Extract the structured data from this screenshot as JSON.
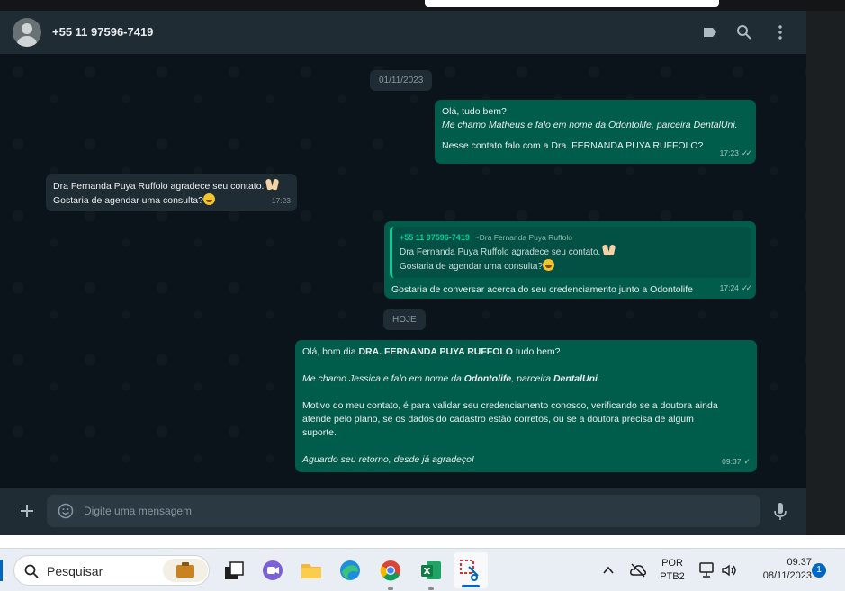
{
  "header": {
    "contact_name": "+55 11 97596-7419",
    "icons": [
      "label-icon",
      "search-icon",
      "menu-icon"
    ]
  },
  "chat": {
    "date_pill_1": "01/11/2023",
    "msg1": {
      "l1": "Olá, tudo bem?",
      "l2": "Me chamo Matheus e falo em nome da Odontolife, parceira DentalUni.",
      "l3": "Nesse contato falo com a Dra. FERNANDA PUYA RUFFOLO?",
      "time": "17:23"
    },
    "msg2": {
      "l1": "Dra Fernanda Puya Ruffolo agradece seu contato.",
      "l2": "Gostaria de agendar uma consulta?",
      "time": "17:23"
    },
    "msg3": {
      "quote_name": "+55 11 97596-7419",
      "quote_sub": "~Dra Fernanda Puya Ruffolo",
      "quote_l1": "Dra Fernanda Puya Ruffolo agradece seu contato.",
      "quote_l2": "Gostaria de agendar uma consulta?",
      "text": "Gostaria de conversar acerca do seu credenciamento junto a Odontolife",
      "time": "17:24"
    },
    "date_pill_2": "HOJE",
    "msg4": {
      "p1a": "Olá, bom dia ",
      "p1b": "DRA. FERNANDA PUYA RUFFOLO",
      "p1c": " tudo bem?",
      "p2a": "Me chamo Jessica e falo em nome da ",
      "p2b": "Odontolife",
      "p2c": ", parceira ",
      "p2d": "DentalUni",
      "p2e": ".",
      "p3l1": "Motivo do meu contato, é para validar seu credenciamento conosco, verificando se a doutora ainda",
      "p3l2": "atende pelo plano, se os dados do cadastro estão corretos, ou se a doutora precisa de algum",
      "p3l3": "suporte.",
      "p4": "Aguardo seu retorno, desde já agradeço!",
      "time": "09:37"
    }
  },
  "footer": {
    "placeholder": "Digite uma mensagem"
  },
  "taskbar": {
    "search_label": "Pesquisar",
    "lang_top": "POR",
    "lang_bottom": "PTB2",
    "time": "09:37",
    "date": "08/11/2023",
    "notification_count": "1"
  },
  "colors": {
    "outgoing_bubble": "#005c4b",
    "incoming_bubble": "#202c33",
    "header_bg": "#202c33",
    "chat_bg": "#0b141a",
    "accent": "#06cf9c"
  }
}
